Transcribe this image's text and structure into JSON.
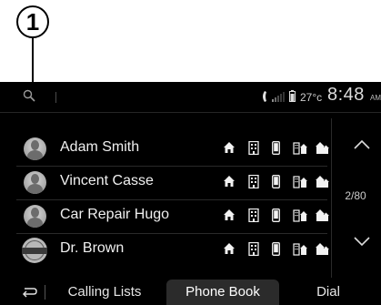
{
  "callout": {
    "number": "1"
  },
  "status_bar": {
    "temperature": "27°c",
    "time": "8:48",
    "ampm": "AM"
  },
  "contacts": [
    {
      "name": "Adam Smith",
      "avatar": "person-avatar"
    },
    {
      "name": "Vincent Casse",
      "avatar": "person-avatar"
    },
    {
      "name": "Car Repair Hugo",
      "avatar": "person-avatar"
    },
    {
      "name": "Dr. Brown",
      "avatar": "nissan-logo-avatar"
    }
  ],
  "contact_number_types": [
    "home-icon",
    "office-icon",
    "mobile-icon",
    "work-icon",
    "other-icon"
  ],
  "list_nav": {
    "page_indicator": "2/80"
  },
  "tabs": {
    "back": "back-arrow-icon",
    "calling_lists": "Calling Lists",
    "phone_book": "Phone Book",
    "dial": "Dial"
  },
  "colors": {
    "screen_bg": "#000000",
    "text": "#f0f0f0",
    "active_tab": "#2b2b2b"
  }
}
